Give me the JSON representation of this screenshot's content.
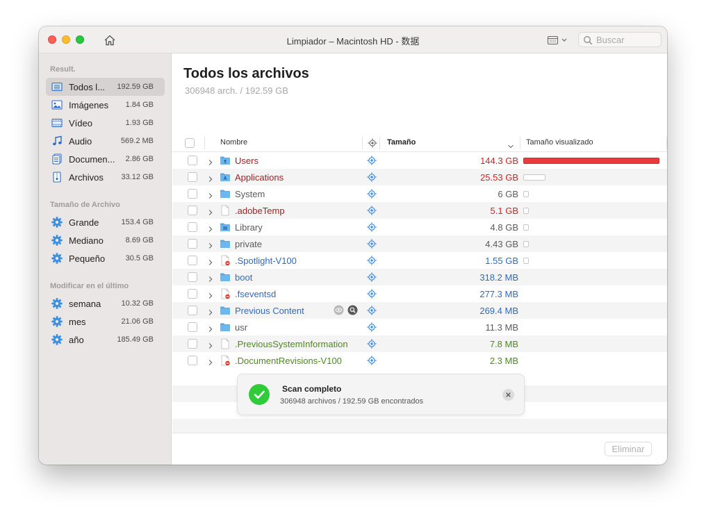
{
  "window": {
    "title": "Limpiador – Macintosh HD - 数据",
    "search_placeholder": "Buscar"
  },
  "sidebar": {
    "results_header": "Result.",
    "results": [
      {
        "label": "Todos l...",
        "size": "192.59 GB",
        "icon": "all-files-icon",
        "active": true
      },
      {
        "label": "Imágenes",
        "size": "1.84 GB",
        "icon": "image-icon"
      },
      {
        "label": "Vídeo",
        "size": "1.93 GB",
        "icon": "film-icon"
      },
      {
        "label": "Audio",
        "size": "569.2 MB",
        "icon": "music-note-icon"
      },
      {
        "label": "Documen...",
        "size": "2.86 GB",
        "icon": "document-icon"
      },
      {
        "label": "Archivos",
        "size": "33.12 GB",
        "icon": "zip-file-icon"
      }
    ],
    "size_header": "Tamaño de Archivo",
    "sizes": [
      {
        "label": "Grande",
        "size": "153.4 GB",
        "icon": "gear-icon"
      },
      {
        "label": "Mediano",
        "size": "8.69 GB",
        "icon": "gear-icon"
      },
      {
        "label": "Pequeño",
        "size": "30.5 GB",
        "icon": "gear-icon"
      }
    ],
    "modified_header": "Modificar en el último",
    "modified": [
      {
        "label": "semana",
        "size": "10.32 GB",
        "icon": "gear-icon"
      },
      {
        "label": "mes",
        "size": "21.06 GB",
        "icon": "gear-icon"
      },
      {
        "label": "año",
        "size": "185.49 GB",
        "icon": "gear-icon"
      }
    ]
  },
  "main": {
    "title": "Todos los archivos",
    "subtitle": "306948 arch. / 192.59 GB",
    "columns": {
      "name": "Nombre",
      "size": "Tamaño",
      "visual": "Tamaño visualizado"
    },
    "rows": [
      {
        "name": "Users",
        "size": "144.3 GB",
        "color": "red",
        "icon": "folder-user-icon",
        "fraction": 1.0
      },
      {
        "name": "Applications",
        "size": "25.53 GB",
        "color": "red",
        "icon": "folder-apps-icon",
        "fraction": 0.177
      },
      {
        "name": "System",
        "size": "6 GB",
        "color": "gray",
        "icon": "folder-icon",
        "fraction": 0.0
      },
      {
        "name": ".adobeTemp",
        "size": "5.1 GB",
        "color": "red",
        "icon": "file-icon",
        "fraction": 0.0
      },
      {
        "name": "Library",
        "size": "4.8 GB",
        "color": "gray",
        "icon": "folder-library-icon",
        "fraction": 0.0
      },
      {
        "name": "private",
        "size": "4.43 GB",
        "color": "gray",
        "icon": "folder-icon",
        "fraction": 0.0
      },
      {
        "name": ".Spotlight-V100",
        "size": "1.55 GB",
        "color": "blue",
        "icon": "restricted-file-icon",
        "fraction": 0.0
      },
      {
        "name": "boot",
        "size": "318.2 MB",
        "color": "blue",
        "icon": "folder-icon"
      },
      {
        "name": ".fseventsd",
        "size": "277.3 MB",
        "color": "blue",
        "icon": "restricted-file-icon"
      },
      {
        "name": "Previous Content",
        "size": "269.4 MB",
        "color": "blue",
        "icon": "folder-icon",
        "actions": true
      },
      {
        "name": "usr",
        "size": "11.3 MB",
        "color": "gray",
        "icon": "folder-icon"
      },
      {
        "name": ".PreviousSystemInformation",
        "size": "7.8 MB",
        "color": "green",
        "icon": "file-icon"
      },
      {
        "name": ".DocumentRevisions-V100",
        "size": "2.3 MB",
        "color": "green",
        "icon": "restricted-file-icon"
      }
    ],
    "delete_label": "Eliminar"
  },
  "toast": {
    "title": "Scan completo",
    "message": "306948 archivos / 192.59 GB encontrados"
  },
  "colors": {
    "accent_blue": "#2d6ac4",
    "folder_blue": "#56a8e8",
    "size_red": "#d32222",
    "bar_red": "#e93b3b",
    "success_green": "#2fcb38"
  }
}
